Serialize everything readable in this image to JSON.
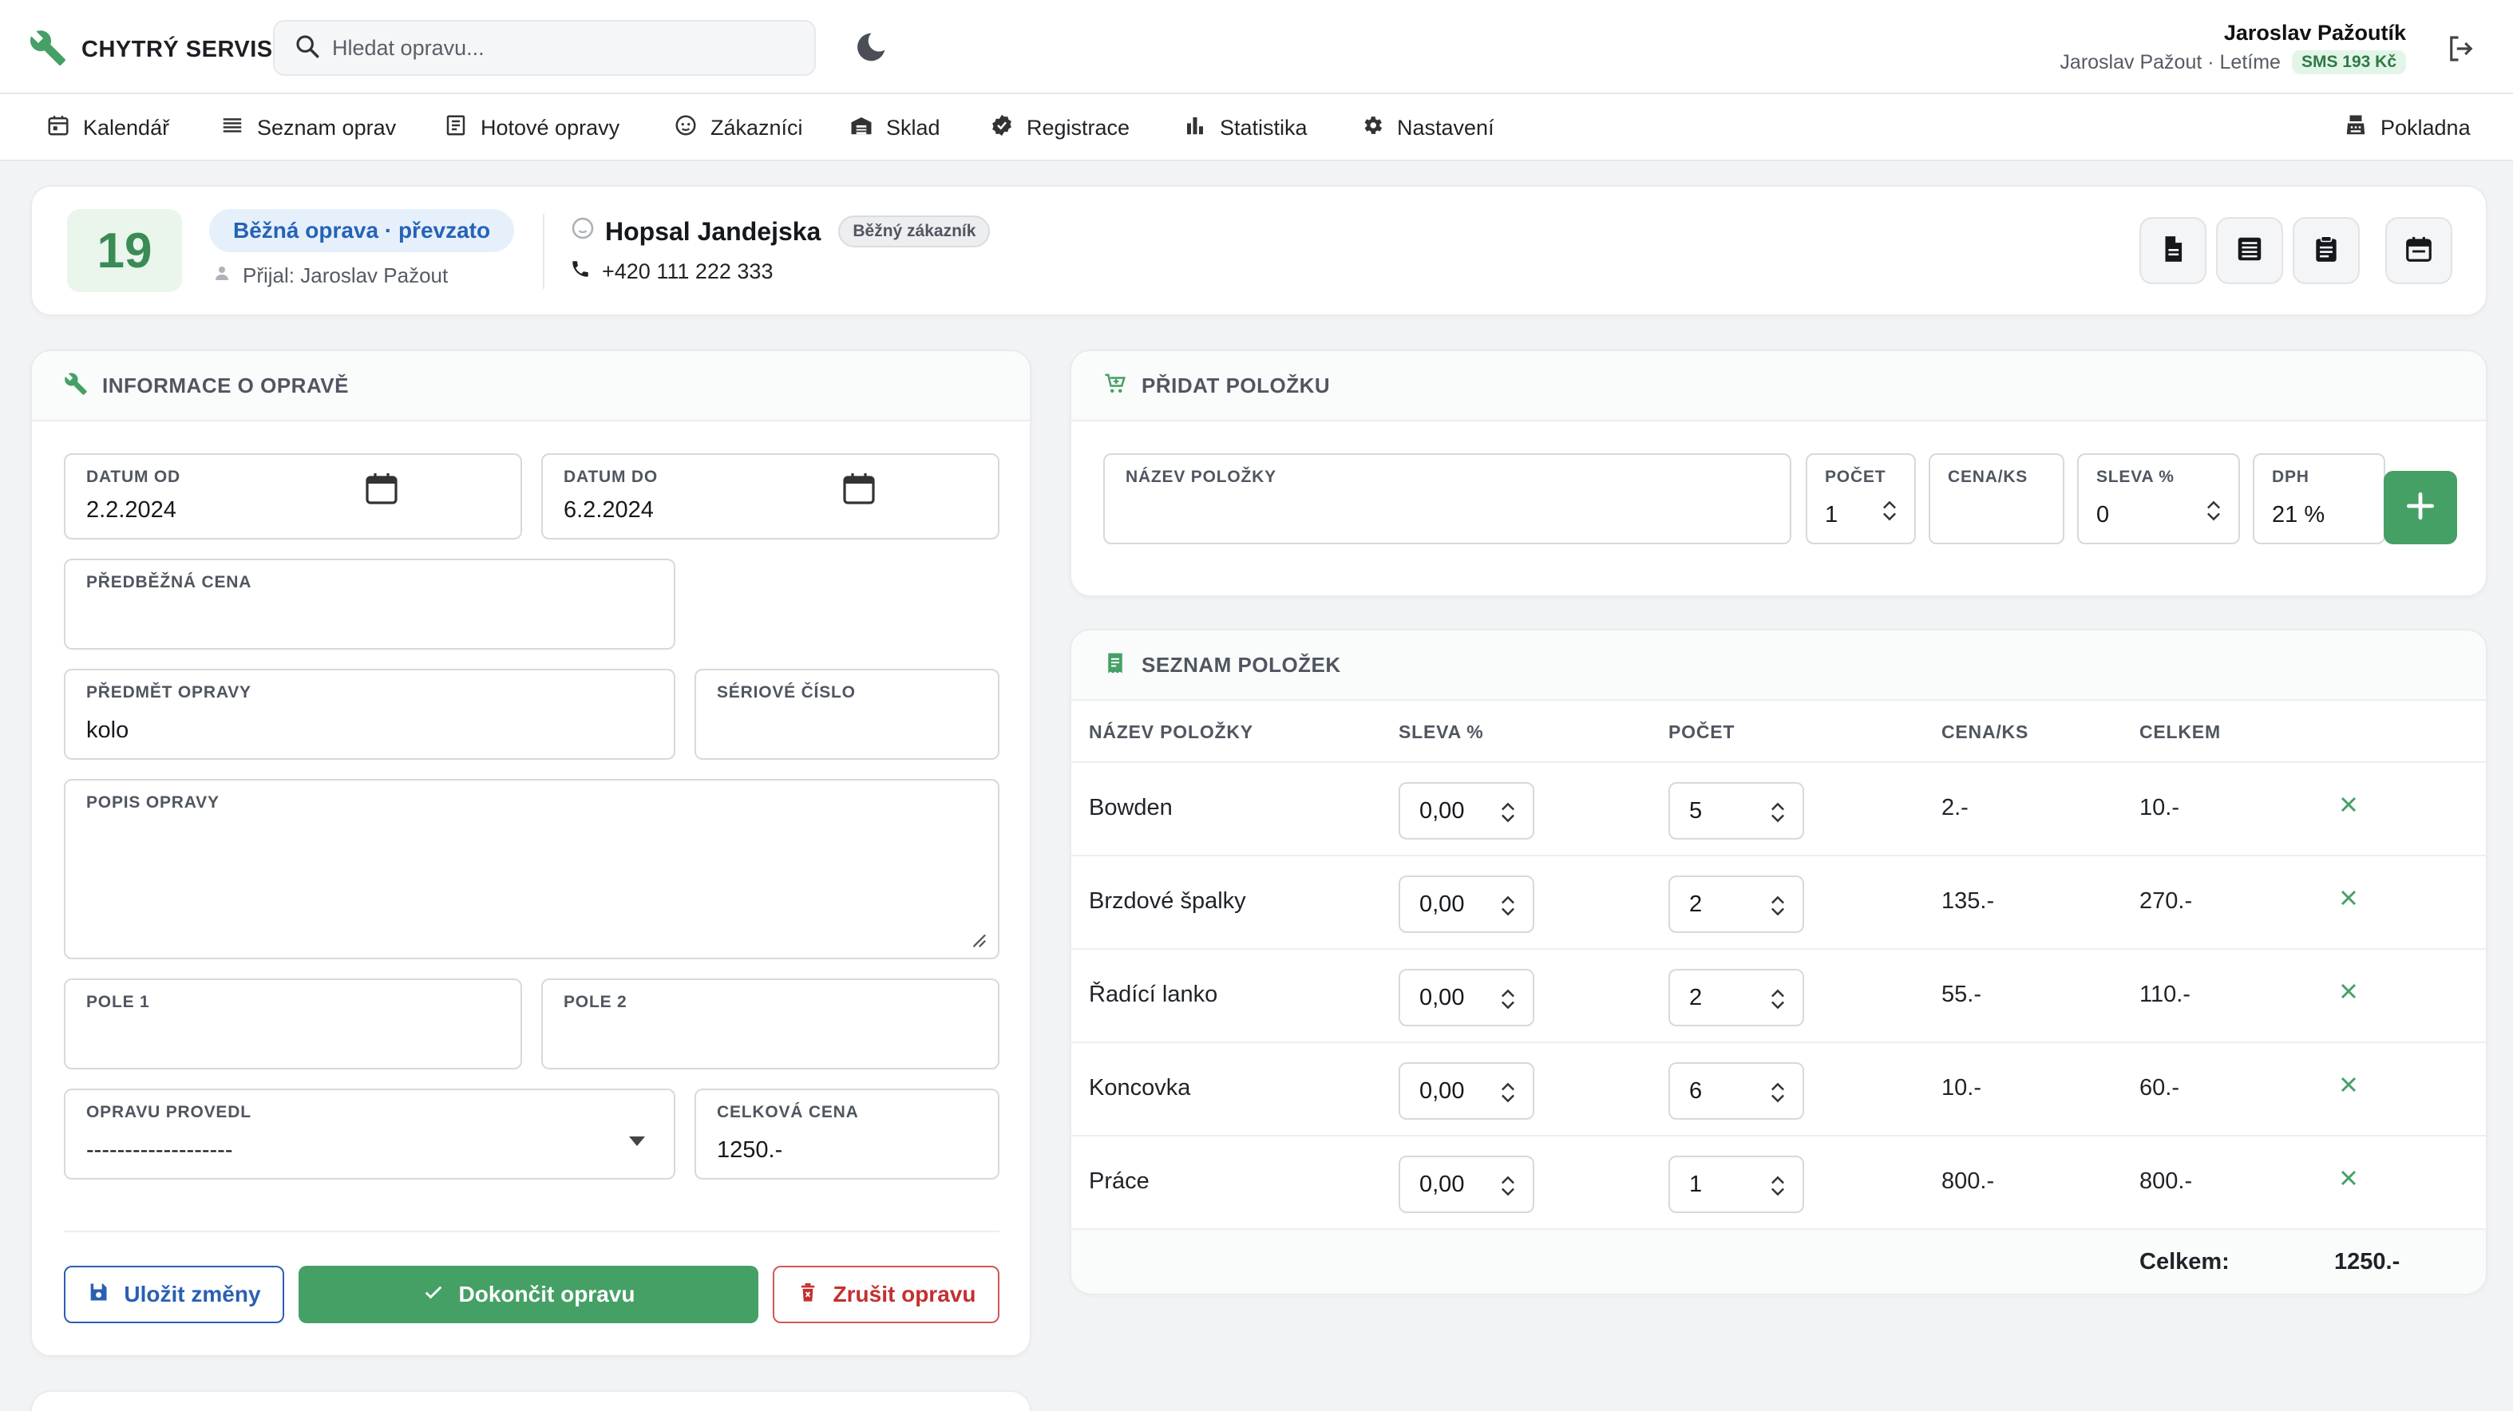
{
  "brand": {
    "name": "CHYTRÝ SERVIS"
  },
  "search": {
    "placeholder": "Hledat opravu..."
  },
  "user": {
    "name": "Jaroslav Pažoutík",
    "sub": "Jaroslav Pažout · Letíme",
    "sms": "SMS 193 Kč"
  },
  "nav": {
    "items": [
      {
        "label": "Kalendář",
        "icon": "calendar-icon"
      },
      {
        "label": "Seznam oprav",
        "icon": "list-icon"
      },
      {
        "label": "Hotové opravy",
        "icon": "checklist-icon"
      },
      {
        "label": "Zákazníci",
        "icon": "face-icon"
      },
      {
        "label": "Sklad",
        "icon": "warehouse-icon"
      },
      {
        "label": "Registrace",
        "icon": "verified-icon"
      },
      {
        "label": "Statistika",
        "icon": "bar-chart-icon"
      },
      {
        "label": "Nastavení",
        "icon": "gear-icon"
      }
    ],
    "register": {
      "label": "Pokladna",
      "icon": "cash-register-icon"
    }
  },
  "repair": {
    "day": "19",
    "status": "Běžná oprava · převzato",
    "receiver": "Přijal: Jaroslav Pažout",
    "customer": {
      "name": "Hopsal Jandejska",
      "badge": "Běžný zákazník",
      "phone": "+420 111 222 333"
    }
  },
  "info": {
    "title": "INFORMACE O OPRAVĚ",
    "date_from": {
      "label": "DATUM OD",
      "value": "2.2.2024"
    },
    "date_to": {
      "label": "DATUM DO",
      "value": "6.2.2024"
    },
    "prelim_price": {
      "label": "PŘEDBĚŽNÁ CENA",
      "value": ""
    },
    "subject": {
      "label": "PŘEDMĚT OPRAVY",
      "value": "kolo"
    },
    "serial": {
      "label": "SÉRIOVÉ ČÍSLO",
      "value": ""
    },
    "description": {
      "label": "POPIS OPRAVY",
      "value": ""
    },
    "field1": {
      "label": "POLE 1",
      "value": ""
    },
    "field2": {
      "label": "POLE 2",
      "value": ""
    },
    "performed_by": {
      "label": "OPRAVU PROVEDL",
      "value": "-------------------"
    },
    "total_price": {
      "label": "CELKOVÁ CENA",
      "value": "1250.-"
    },
    "buttons": {
      "save": "Uložit změny",
      "finish": "Dokončit opravu",
      "cancel": "Zrušit opravu"
    }
  },
  "add_item": {
    "title": "PŘIDAT POLOŽKU",
    "name": {
      "label": "NÁZEV POLOŽKY",
      "value": ""
    },
    "count": {
      "label": "POČET",
      "value": "1"
    },
    "price": {
      "label": "CENA/KS",
      "value": ""
    },
    "discount": {
      "label": "SLEVA %",
      "value": "0"
    },
    "vat": {
      "label": "DPH",
      "value": "21 %"
    }
  },
  "items": {
    "title": "SEZNAM POLOŽEK",
    "headers": [
      "NÁZEV POLOŽKY",
      "SLEVA %",
      "POČET",
      "CENA/KS",
      "CELKEM"
    ],
    "rows": [
      {
        "name": "Bowden",
        "discount": "0,00",
        "count": "5",
        "price": "2.-",
        "total": "10.-"
      },
      {
        "name": "Brzdové špalky",
        "discount": "0,00",
        "count": "2",
        "price": "135.-",
        "total": "270.-"
      },
      {
        "name": "Řadící lanko",
        "discount": "0,00",
        "count": "2",
        "price": "55.-",
        "total": "110.-"
      },
      {
        "name": "Koncovka",
        "discount": "0,00",
        "count": "6",
        "price": "10.-",
        "total": "60.-"
      },
      {
        "name": "Práce",
        "discount": "0,00",
        "count": "1",
        "price": "800.-",
        "total": "800.-"
      }
    ],
    "total_label": "Celkem:",
    "total_value": "1250.-"
  },
  "colors": {
    "accent_green": "#45a065",
    "accent_blue": "#2b5fb3",
    "danger": "#c33030"
  }
}
